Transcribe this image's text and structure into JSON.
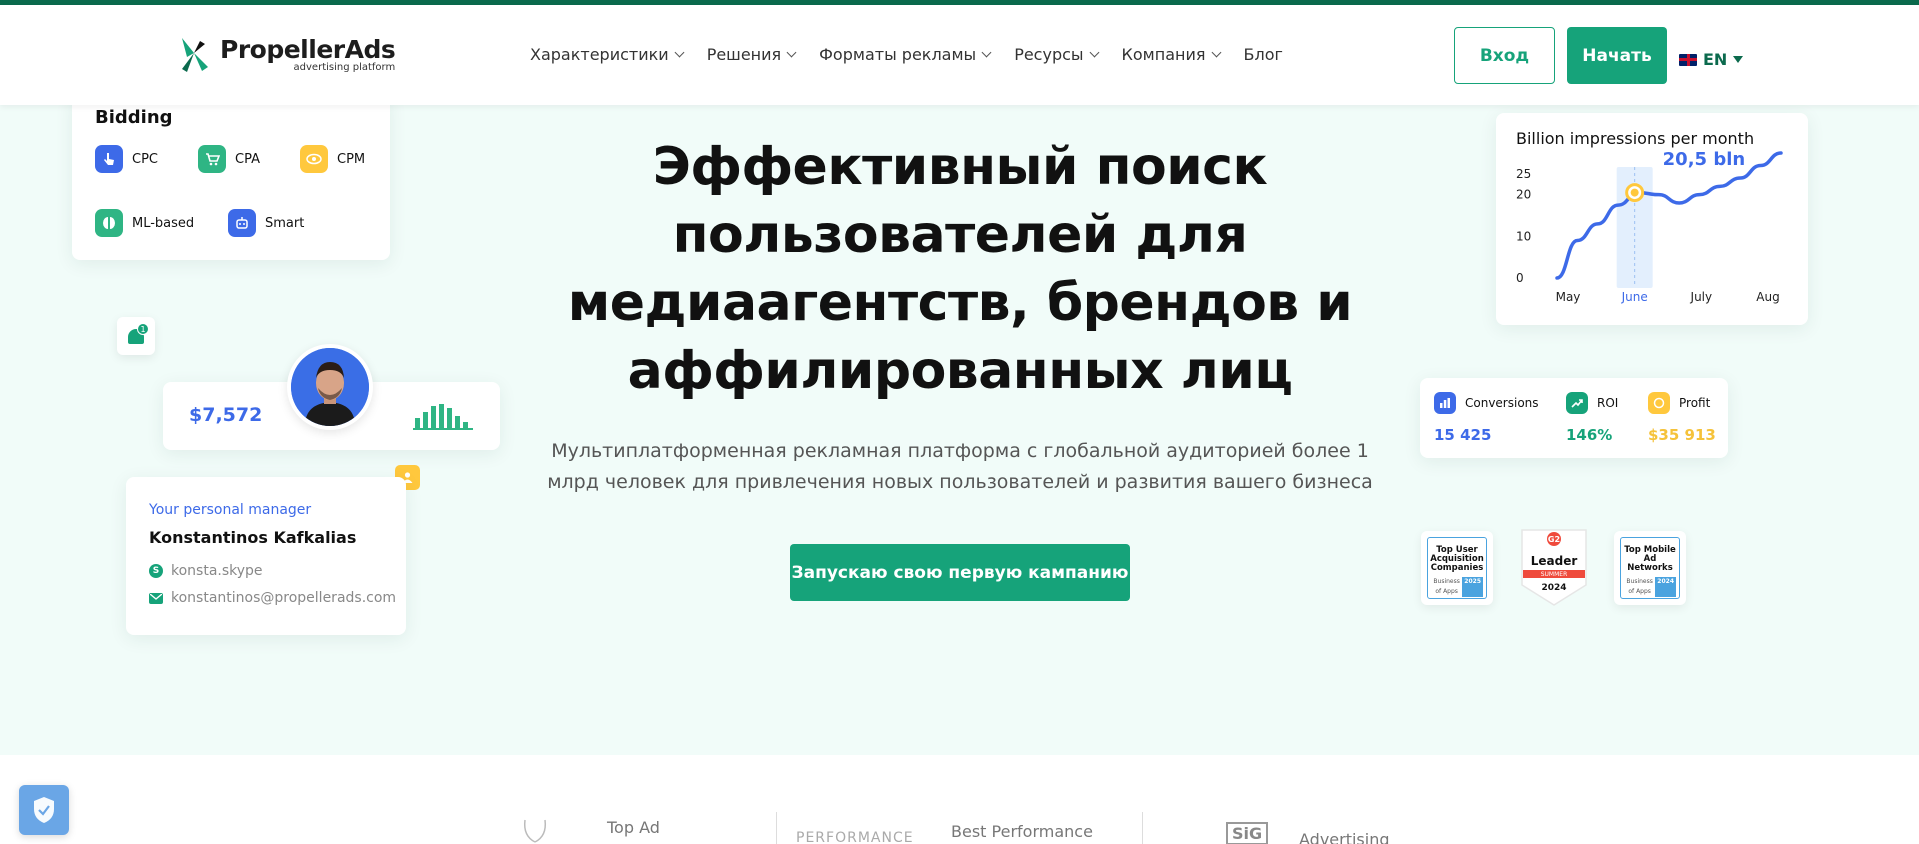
{
  "header": {
    "logo": {
      "name": "PropellerAds",
      "tagline": "advertising platform"
    },
    "nav": [
      {
        "label": "Характеристики",
        "dropdown": true
      },
      {
        "label": "Решения",
        "dropdown": true
      },
      {
        "label": "Форматы рекламы",
        "dropdown": true
      },
      {
        "label": "Ресурсы",
        "dropdown": true
      },
      {
        "label": "Компания",
        "dropdown": true
      },
      {
        "label": "Блог",
        "dropdown": false
      }
    ],
    "login_label": "Вход",
    "start_label": "Начать",
    "language": "EN"
  },
  "hero": {
    "title_lines": [
      "Эффективный поиск",
      "пользователей для",
      "медиаагентств, брендов и",
      "аффилированных лиц"
    ],
    "subtitle_lines": [
      "Мультиплатформенная рекламная платформа с глобальной аудиторией более 1",
      "млрд человек для привлечения новых пользователей и развития вашего бизнеса"
    ],
    "cta_label": "Запускаю свою первую кампанию"
  },
  "bidding": {
    "title": "Bidding",
    "items": [
      {
        "label": "CPC",
        "icon": "pointer-icon",
        "color": "#3d6ae8"
      },
      {
        "label": "CPA",
        "icon": "cart-icon",
        "color": "#2fb584"
      },
      {
        "label": "CPM",
        "icon": "eye-icon",
        "color": "#ffc83d"
      },
      {
        "label": "ML-based",
        "icon": "ml-icon",
        "color": "#2fb584"
      },
      {
        "label": "Smart",
        "icon": "robot-icon",
        "color": "#3d6ae8"
      }
    ]
  },
  "notification": {
    "count": "1"
  },
  "earnings": {
    "amount": "$7,572"
  },
  "manager": {
    "label": "Your personal manager",
    "name": "Konstantinos Kafkalias",
    "skype": "konsta.skype",
    "email": "konstantinos@propellerads.com"
  },
  "chart_data": {
    "type": "line",
    "title": "Billion impressions per month",
    "categories": [
      "May",
      "June",
      "July",
      "Aug"
    ],
    "yticks": [
      0,
      10,
      20,
      25
    ],
    "ylim": [
      0,
      30
    ],
    "highlight": {
      "category": "June",
      "label": "20,5 bln",
      "value": 20.5
    },
    "series": [
      {
        "values": [
          0,
          9,
          13,
          17.5,
          20.5,
          20,
          18,
          20,
          22,
          24,
          27,
          30
        ]
      }
    ],
    "colors": {
      "line": "#3d6ae8",
      "highlight_band": "#e3effd",
      "marker": "#ffc83d"
    }
  },
  "kpis": [
    {
      "label": "Conversions",
      "value": "15 425",
      "color": "#3d6ae8",
      "icon": "bar-chart-icon"
    },
    {
      "label": "ROI",
      "value": "146%",
      "color": "#16a37a",
      "icon": "trend-up-icon"
    },
    {
      "label": "Profit",
      "value": "$35 913",
      "color": "#f5c23a",
      "icon": "coin-icon"
    }
  ],
  "awards": [
    {
      "text": "Top User Acquisition Companies",
      "source": "Business of Apps",
      "year": "2025"
    },
    {
      "text": "Leader",
      "season": "SUMMER",
      "year": "2024"
    },
    {
      "text": "Top Mobile Ad Networks",
      "source": "Business of Apps",
      "year": "2024"
    }
  ],
  "partners": [
    "Top Ad",
    "PERFORMANCE",
    "Best Performance",
    "SiG",
    "Advertising"
  ]
}
